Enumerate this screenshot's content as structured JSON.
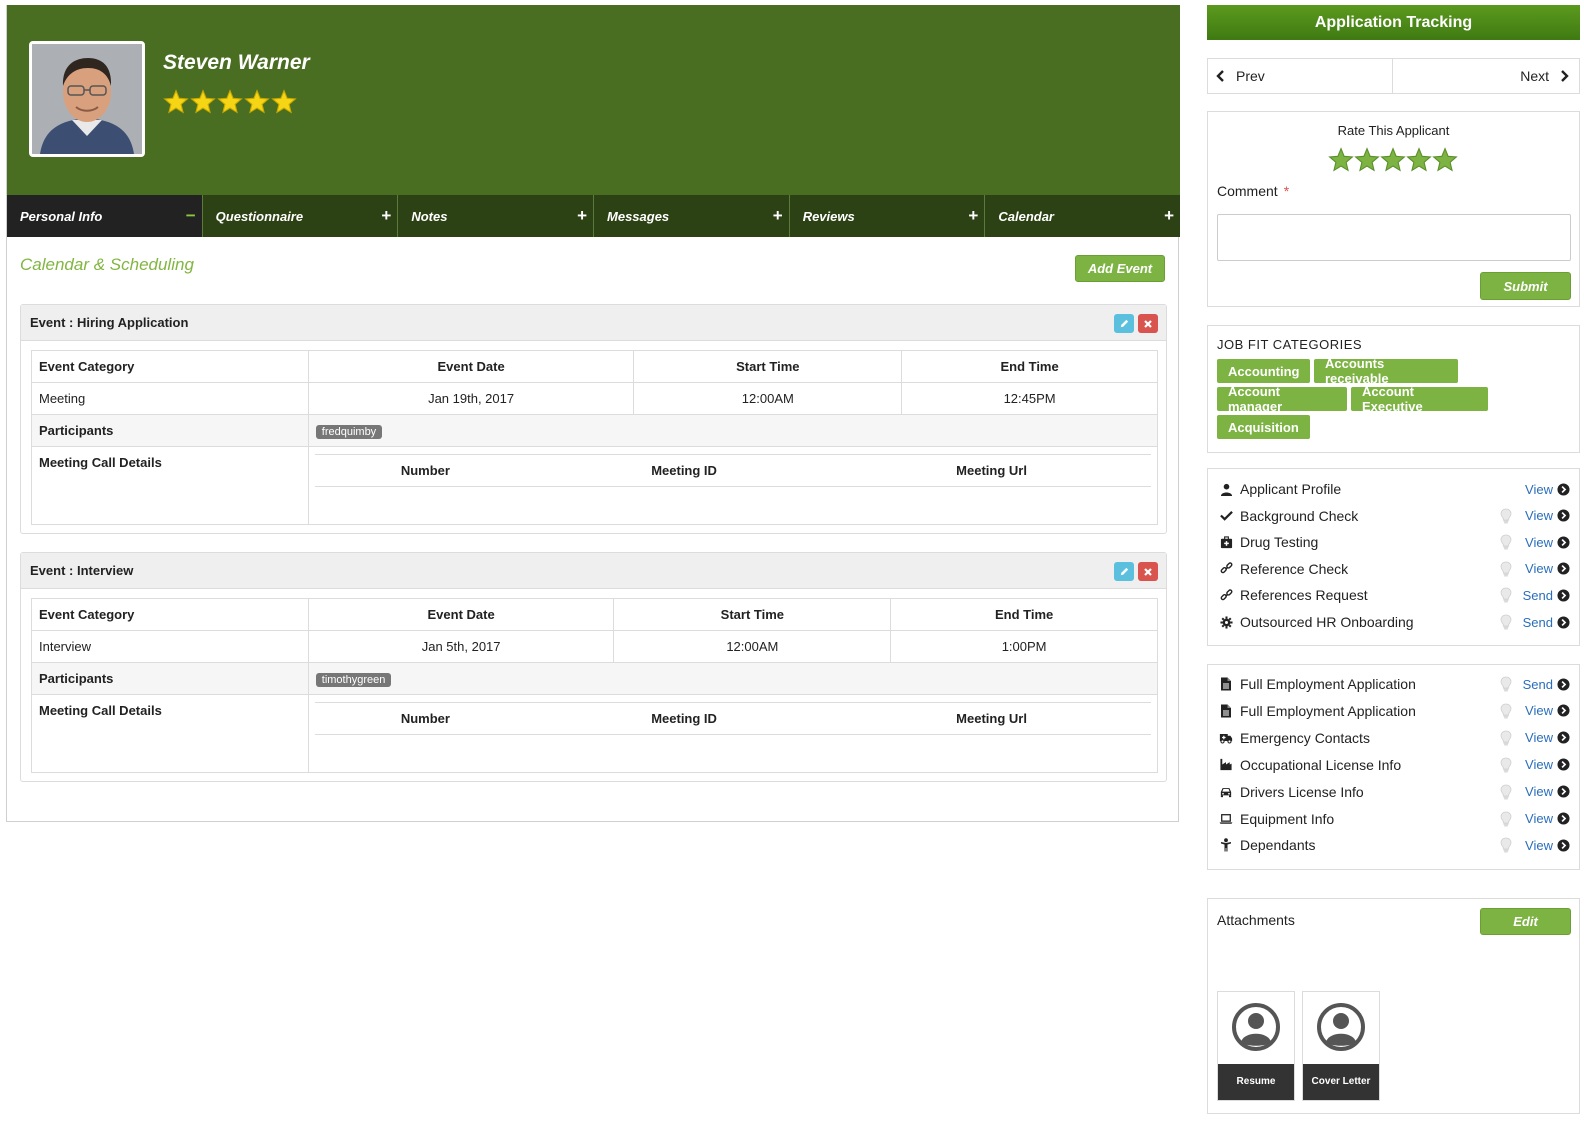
{
  "applicant": {
    "name": "Steven Warner",
    "rating": 5
  },
  "tabs": [
    {
      "label": "Personal Info",
      "sign": "−"
    },
    {
      "label": "Questionnaire",
      "sign": "+"
    },
    {
      "label": "Notes",
      "sign": "+"
    },
    {
      "label": "Messages",
      "sign": "+"
    },
    {
      "label": "Reviews",
      "sign": "+"
    },
    {
      "label": "Calendar",
      "sign": "+"
    }
  ],
  "calendar": {
    "title": "Calendar & Scheduling",
    "add_event_label": "Add Event",
    "headers": {
      "category": "Event Category",
      "date": "Event Date",
      "start": "Start Time",
      "end": "End Time"
    },
    "participants_label": "Participants",
    "meeting_details_label": "Meeting Call Details",
    "call_headers": {
      "number": "Number",
      "meeting_id": "Meeting ID",
      "meeting_url": "Meeting Url"
    },
    "events": [
      {
        "title": "Event : Hiring Application",
        "category": "Meeting",
        "date": "Jan 19th, 2017",
        "start": "12:00AM",
        "end": "12:45PM",
        "participant": "fredquimby"
      },
      {
        "title": "Event : Interview",
        "category": "Interview",
        "date": "Jan 5th, 2017",
        "start": "12:00AM",
        "end": "1:00PM",
        "participant": "timothygreen"
      }
    ]
  },
  "sidebar": {
    "title": "Application Tracking",
    "prev_label": "Prev",
    "next_label": "Next",
    "rate_label": "Rate This Applicant",
    "rate_value": 5,
    "comment_label": "Comment",
    "required_mark": "*",
    "submit_label": "Submit",
    "job_fit_title": "JOB FIT CATEGORIES",
    "job_fit": [
      "Accounting",
      "Accounts receivable",
      "Account manager",
      "Account Executive",
      "Acquisition"
    ],
    "checks": [
      {
        "label": "Applicant Profile",
        "action": "View",
        "icon": "user-icon"
      },
      {
        "label": "Background Check",
        "action": "View",
        "icon": "checkmark-icon"
      },
      {
        "label": "Drug Testing",
        "action": "View",
        "icon": "medkit-icon"
      },
      {
        "label": "Reference Check",
        "action": "View",
        "icon": "link-icon"
      },
      {
        "label": "References Request",
        "action": "Send",
        "icon": "link-icon"
      },
      {
        "label": "Outsourced HR Onboarding",
        "action": "Send",
        "icon": "gear-icon"
      }
    ],
    "forms": [
      {
        "label": "Full Employment Application",
        "action": "Send",
        "icon": "file-icon"
      },
      {
        "label": "Full Employment Application",
        "action": "View",
        "icon": "file-icon"
      },
      {
        "label": "Emergency Contacts",
        "action": "View",
        "icon": "ambulance-icon"
      },
      {
        "label": "Occupational License Info",
        "action": "View",
        "icon": "industry-icon"
      },
      {
        "label": "Drivers License Info",
        "action": "View",
        "icon": "car-icon"
      },
      {
        "label": "Equipment Info",
        "action": "View",
        "icon": "laptop-icon"
      },
      {
        "label": "Dependants",
        "action": "View",
        "icon": "child-icon"
      }
    ],
    "attachments_title": "Attachments",
    "attachments_edit": "Edit",
    "attachments": [
      {
        "label": "Resume"
      },
      {
        "label": "Cover Letter"
      }
    ]
  },
  "colors": {
    "hero": "#4a6e21",
    "tabbar": "#2d4214",
    "accent": "#7cb342",
    "link": "#2a6ebb",
    "star": "#f5d514"
  }
}
